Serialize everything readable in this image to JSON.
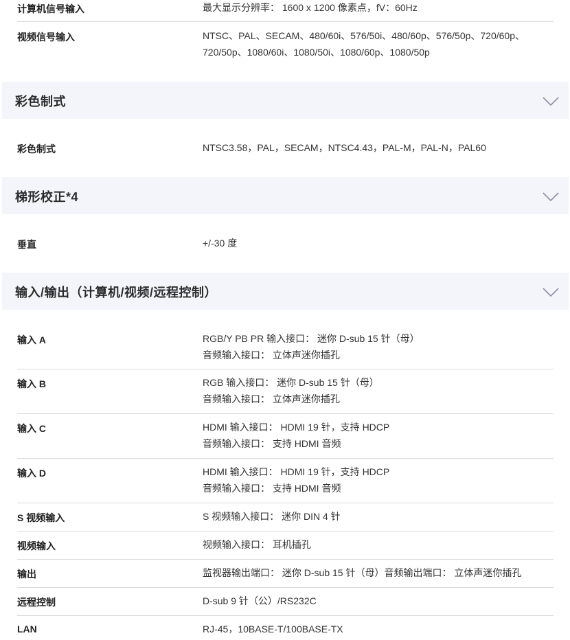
{
  "top_rows": [
    {
      "label": "计算机信号输入",
      "lines": [
        "最大显示分辨率： 1600 x 1200 像素点，fV：60Hz"
      ]
    },
    {
      "label": "视频信号输入",
      "lines": [
        "NTSC、PAL、SECAM、480/60i、576/50i、480/60p、576/50p、720/60p、",
        "720/50p、1080/60i、1080/50i、1080/60p、1080/50p"
      ]
    }
  ],
  "sections": [
    {
      "title": "彩色制式",
      "rows": [
        {
          "label": "彩色制式",
          "lines": [
            "NTSC3.58，PAL，SECAM，NTSC4.43，PAL-M，PAL-N，PAL60"
          ]
        }
      ]
    },
    {
      "title": "梯形校正*4",
      "rows": [
        {
          "label": "垂直",
          "lines": [
            "+/-30 度"
          ]
        }
      ]
    },
    {
      "title": "输入/输出（计算机/视频/远程控制）",
      "rows": [
        {
          "label": "输入 A",
          "lines": [
            "RGB/Y PB PR 输入接口： 迷你 D-sub 15 针（母）",
            "音频输入接口： 立体声迷你插孔"
          ]
        },
        {
          "label": "输入 B",
          "lines": [
            "RGB 输入接口： 迷你 D-sub 15 针（母）",
            "音频输入接口： 立体声迷你插孔"
          ]
        },
        {
          "label": "输入 C",
          "lines": [
            "HDMI 输入接口： HDMI 19 针，支持 HDCP",
            "音频输入接口： 支持 HDMI 音频"
          ]
        },
        {
          "label": "输入 D",
          "lines": [
            "HDMI 输入接口： HDMI 19 针，支持 HDCP",
            "音频输入接口： 支持 HDMI 音频"
          ]
        },
        {
          "label": "S 视频输入",
          "lines": [
            "S 视频输入接口： 迷你 DIN 4 针"
          ]
        },
        {
          "label": "视频输入",
          "lines": [
            "视频输入接口： 耳机插孔"
          ]
        },
        {
          "label": "输出",
          "lines": [
            "监视器输出端口： 迷你 D-sub 15 针（母）音频输出端口： 立体声迷你插孔"
          ]
        },
        {
          "label": "远程控制",
          "lines": [
            "D-sub 9 针（公）/RS232C"
          ]
        },
        {
          "label": "LAN",
          "lines": [
            "RJ-45，10BASE-T/100BASE-TX"
          ]
        }
      ]
    }
  ],
  "colors": {
    "section_bg": "#f4f5fa",
    "divider": "#d9d9d9",
    "chevron": "#8a8fa3"
  },
  "icons": {
    "section_toggle": "chevron-down-icon"
  }
}
